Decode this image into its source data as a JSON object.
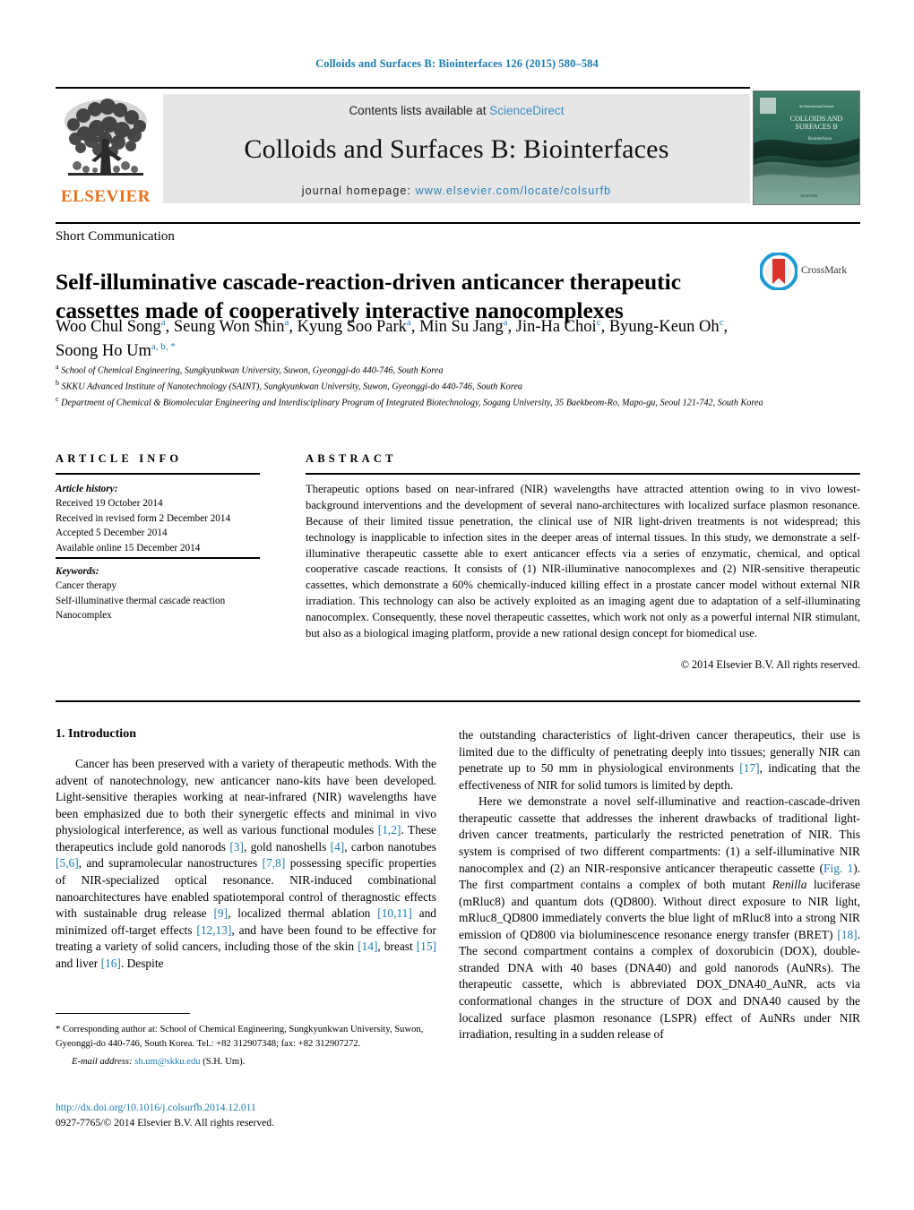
{
  "running_head": "Colloids and Surfaces B: Biointerfaces 126 (2015) 580–584",
  "masthead": {
    "publisher": "ELSEVIER",
    "contents_prefix": "Contents lists available at ",
    "contents_link": "ScienceDirect",
    "journal_title": "Colloids and Surfaces B: Biointerfaces",
    "homepage_prefix": "journal homepage: ",
    "homepage_link": "www.elsevier.com/locate/colsurfb",
    "cover_line1": "COLLOIDS AND",
    "cover_line2": "SURFACES B"
  },
  "article": {
    "type": "Short Communication",
    "title": "Self-illuminative cascade-reaction-driven anticancer therapeutic cassettes made of cooperatively interactive nanocomplexes",
    "crossmark_label": "CrossMark",
    "authors_line1": "Woo Chul Song",
    "authors_html": "Woo Chul Song<sup>a</sup>, Seung Won Shin<sup>a</sup>, Kyung Soo Park<sup>a</sup>, Min Su Jang<sup>a</sup>, Jin-Ha Choi<sup>c</sup>, Byung-Keun Oh<sup>c</sup>, Soong Ho Um<sup>a, b,</sup><sup>*</sup>",
    "affiliations": [
      {
        "mark": "a",
        "text": "School of Chemical Engineering, Sungkyunkwan University, Suwon, Gyeonggi-do 440-746, South Korea"
      },
      {
        "mark": "b",
        "text": "SKKU Advanced Institute of Nanotechnology (SAINT), Sungkyunkwan University, Suwon, Gyeonggi-do 440-746, South Korea"
      },
      {
        "mark": "c",
        "text": "Department of Chemical & Biomolecular Engineering and Interdisciplinary Program of Integrated Biotechnology, Sogang University, 35 Baekbeom-Ro, Mapo-gu, Seoul 121-742, South Korea"
      }
    ]
  },
  "info": {
    "info_heading": "ARTICLE INFO",
    "abstract_heading": "ABSTRACT",
    "history_title": "Article history:",
    "history": [
      "Received 19 October 2014",
      "Received in revised form 2 December 2014",
      "Accepted 5 December 2014",
      "Available online 15 December 2014"
    ],
    "keywords_title": "Keywords:",
    "keywords": [
      "Cancer therapy",
      "Self-illuminative thermal cascade reaction",
      "Nanocomplex"
    ]
  },
  "abstract": {
    "text": "Therapeutic options based on near-infrared (NIR) wavelengths have attracted attention owing to in vivo lowest-background interventions and the development of several nano-architectures with localized surface plasmon resonance. Because of their limited tissue penetration, the clinical use of NIR light-driven treatments is not widespread; this technology is inapplicable to infection sites in the deeper areas of internal tissues. In this study, we demonstrate a self-illuminative therapeutic cassette able to exert anticancer effects via a series of enzymatic, chemical, and optical cooperative cascade reactions. It consists of (1) NIR-illuminative nanocomplexes and (2) NIR-sensitive therapeutic cassettes, which demonstrate a 60% chemically-induced killing effect in a prostate cancer model without external NIR irradiation. This technology can also be actively exploited as an imaging agent due to adaptation of a self-illuminating nanocomplex. Consequently, these novel therapeutic cassettes, which work not only as a powerful internal NIR stimulant, but also as a biological imaging platform, provide a new rational design concept for biomedical use.",
    "copyright": "© 2014 Elsevier B.V. All rights reserved."
  },
  "body": {
    "section_number_title": "1.  Introduction",
    "left_paragraph_1_a": "Cancer has been preserved with a variety of therapeutic methods. With the advent of nanotechnology, new anticancer nano-kits have been developed. Light-sensitive therapies working at near-infrared (NIR) wavelengths have been emphasized due to both their synergetic effects and minimal in vivo physiological interference, as well as various functional modules ",
    "ref_1_2": "[1,2]",
    "left_paragraph_1_b": ". These therapeutics include gold nanorods ",
    "ref_3": "[3]",
    "left_paragraph_1_c": ", gold nanoshells ",
    "ref_4": "[4]",
    "left_paragraph_1_d": ", carbon nanotubes ",
    "ref_5_6": "[5,6]",
    "left_paragraph_1_e": ", and supramolecular nanostructures ",
    "ref_7_8": "[7,8]",
    "left_paragraph_1_f": " possessing specific properties of NIR-specialized optical resonance. NIR-induced combinational nanoarchitectures have enabled spatiotemporal control of theragnostic effects with sustainable drug release ",
    "ref_9": "[9]",
    "left_paragraph_1_g": ", localized thermal ablation ",
    "ref_10_11": "[10,11]",
    "left_paragraph_1_h": " and minimized off-target effects ",
    "ref_12_13": "[12,13]",
    "left_paragraph_1_i": ", and have been found to be effective for treating a variety of solid cancers, including those of the skin ",
    "ref_14": "[14]",
    "left_paragraph_1_j": ", breast ",
    "ref_15": "[15]",
    "left_paragraph_1_k": " and liver ",
    "ref_16": "[16]",
    "left_paragraph_1_l": ". Despite",
    "right_paragraph_1_a": "the outstanding characteristics of light-driven cancer therapeutics, their use is limited due to the difficulty of penetrating deeply into tissues; generally NIR can penetrate up to 50 mm in physiological environments ",
    "ref_17": "[17]",
    "right_paragraph_1_b": ", indicating that the effectiveness of NIR for solid tumors is limited by depth.",
    "right_paragraph_2_a": "Here we demonstrate a novel self-illuminative and reaction-cascade-driven therapeutic cassette that addresses the inherent drawbacks of traditional light-driven cancer treatments, particularly the restricted penetration of NIR. This system is comprised of two different compartments: (1) a self-illuminative NIR nanocomplex and (2) an NIR-responsive anticancer therapeutic cassette (",
    "figref_1": "Fig. 1",
    "right_paragraph_2_b": "). The first compartment contains a complex of both mutant ",
    "renilla": "Renilla",
    "right_paragraph_2_c": " luciferase (mRluc8) and quantum dots (QD800). Without direct exposure to NIR light, mRluc8_QD800 immediately converts the blue light of mRluc8 into a strong NIR emission of QD800 via bioluminescence resonance energy transfer (BRET) ",
    "ref_18": "[18]",
    "right_paragraph_2_d": ". The second compartment contains a complex of doxorubicin (DOX), double-stranded DNA with 40 bases (DNA40) and gold nanorods (AuNRs). The therapeutic cassette, which is abbreviated DOX_DNA40_AuNR, acts via conformational changes in the structure of DOX and DNA40 caused by the localized surface plasmon resonance (LSPR) effect of AuNRs under NIR irradiation, resulting in a sudden release of"
  },
  "footnotes": {
    "corresponding": "* Corresponding author at: School of Chemical Engineering, Sungkyunkwan University, Suwon, Gyeonggi-do 440-746, South Korea. Tel.: +82 312907348; fax: +82 312907272.",
    "email_label": "E-mail address:",
    "email": "sh.um@skku.edu",
    "email_suffix": "(S.H. Um).",
    "doi": "http://dx.doi.org/10.1016/j.colsurfb.2014.12.011",
    "issn_line": "0927-7765/© 2014 Elsevier B.V. All rights reserved."
  },
  "colors": {
    "link_blue": "#1a7bb0",
    "elsevier_orange": "#E9711C",
    "band_gray": "#e6e6e6"
  }
}
